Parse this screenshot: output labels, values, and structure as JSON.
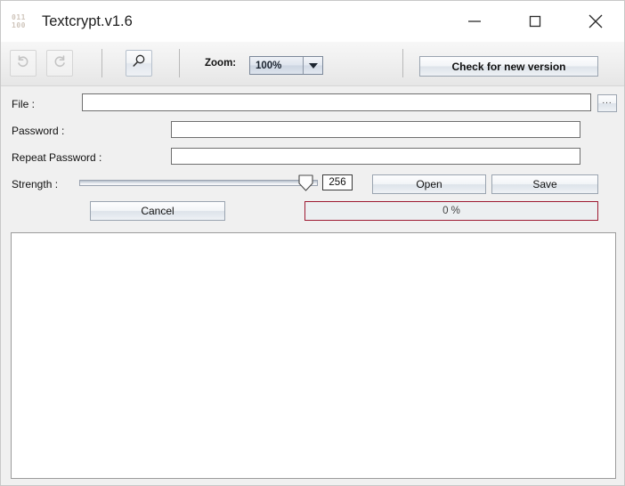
{
  "window": {
    "title": "Textcrypt.v1.6",
    "icon_name": "binary-app-icon",
    "icon_line1": "011",
    "icon_line2": "100",
    "controls": {
      "minimize": "minimize-button",
      "maximize": "maximize-button",
      "close": "close-button"
    }
  },
  "toolbar": {
    "undo_label": "Undo",
    "redo_label": "Redo",
    "search_label": "Search",
    "zoom_label": "Zoom:",
    "zoom_value": "100%",
    "zoom_options": [
      "100%"
    ],
    "check_version_label": "Check for new version"
  },
  "form": {
    "file_label": "File :",
    "file_value": "",
    "file_placeholder": "",
    "browse_label": "...",
    "password_label": "Password :",
    "password_value": "",
    "password_placeholder": "",
    "repeat_label": "Repeat Password :",
    "repeat_value": "",
    "repeat_placeholder": "",
    "strength_label": "Strength :",
    "strength_value": "256",
    "strength_min": 0,
    "strength_max": 256,
    "open_label": "Open",
    "save_label": "Save"
  },
  "actions": {
    "cancel_label": "Cancel",
    "progress_text": "0 %",
    "progress_percent": 0
  },
  "editor": {
    "content": "",
    "placeholder": ""
  },
  "colors": {
    "window_bg": "#f0f0f0",
    "titlebar_bg": "#ffffff",
    "toolbar_bg": "#eeeeee",
    "progress_border": "#9e1b33",
    "input_border": "#6f6f6f",
    "button_border": "#9aa4b0",
    "combo_border": "#7c8899",
    "icon_tint": "#cfc5bb"
  }
}
